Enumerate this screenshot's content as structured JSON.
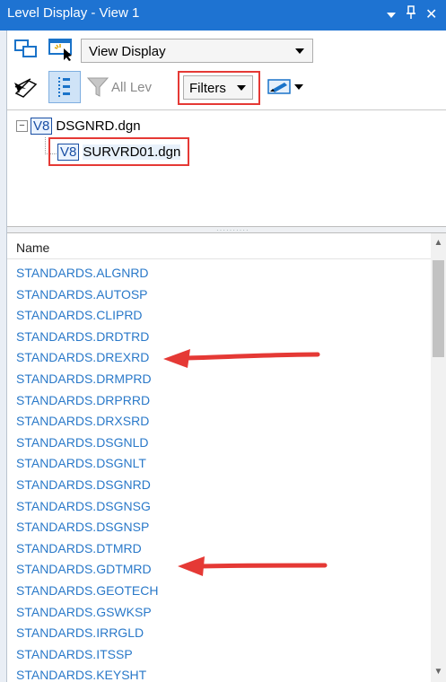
{
  "window": {
    "title": "Level Display - View 1",
    "pin_label": "⏷",
    "close_label": "✕"
  },
  "toolbar": {
    "view_dropdown": "View Display",
    "level_filter_placeholder": "All Lev",
    "filters_dropdown": "Filters"
  },
  "tree": {
    "root_label": "DSGNRD.dgn",
    "child_label": "SURVRD01.dgn",
    "badge": "V8",
    "expander": "−"
  },
  "list": {
    "column_header": "Name",
    "items": [
      "STANDARDS.ALGNRD",
      "STANDARDS.AUTOSP",
      "STANDARDS.CLIPRD",
      "STANDARDS.DRDTRD",
      "STANDARDS.DREXRD",
      "STANDARDS.DRMPRD",
      "STANDARDS.DRPRRD",
      "STANDARDS.DRXSRD",
      "STANDARDS.DSGNLD",
      "STANDARDS.DSGNLT",
      "STANDARDS.DSGNRD",
      "STANDARDS.DSGNSG",
      "STANDARDS.DSGNSP",
      "STANDARDS.DTMRD",
      "STANDARDS.GDTMRD",
      "STANDARDS.GEOTECH",
      "STANDARDS.GSWKSP",
      "STANDARDS.IRRGLD",
      "STANDARDS.ITSSP",
      "STANDARDS.KEYSHT"
    ]
  },
  "colors": {
    "title_bar": "#1e73d2",
    "list_text": "#2a79c9",
    "annotation_red": "#e53935"
  }
}
